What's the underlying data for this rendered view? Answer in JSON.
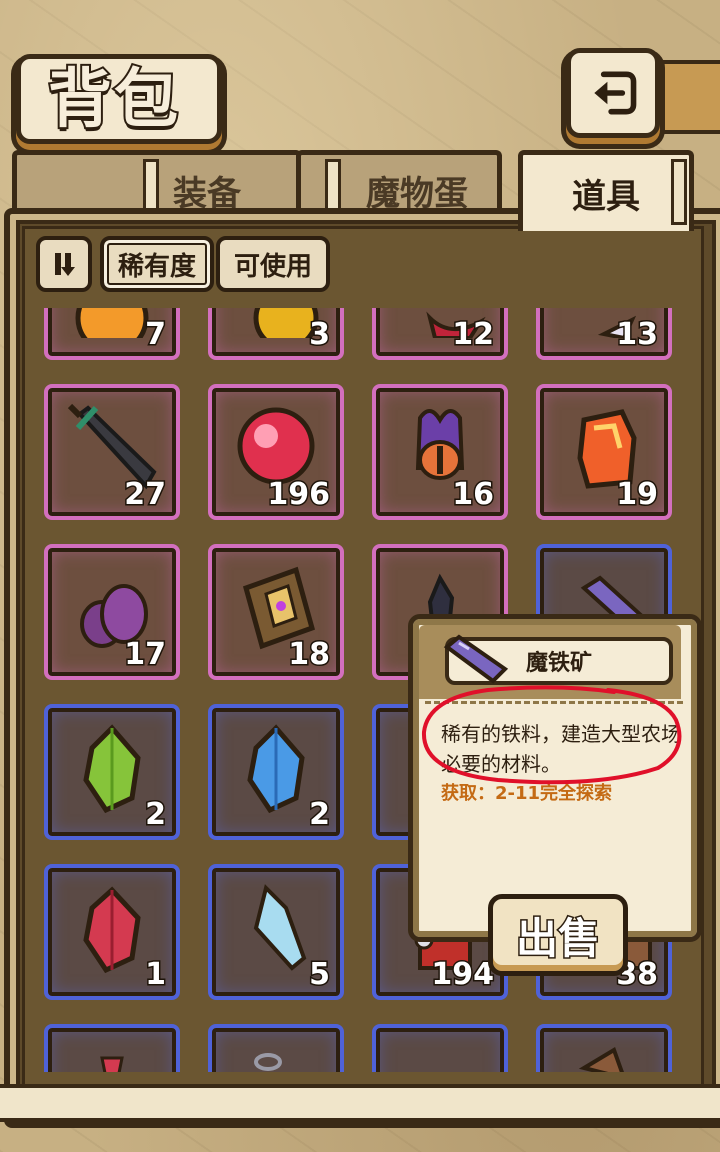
{
  "header": {
    "title": "背包"
  },
  "tabs": [
    {
      "label": "装备",
      "active": false
    },
    {
      "label": "魔物蛋",
      "active": false
    },
    {
      "label": "道具",
      "active": true
    }
  ],
  "toolbar": {
    "filters": [
      {
        "label": "稀有度",
        "selected": true
      },
      {
        "label": "可使用",
        "selected": false
      }
    ]
  },
  "items": [
    {
      "name": "orange-orb-icon",
      "count": "7",
      "rarity": "epic"
    },
    {
      "name": "gold-orb-icon",
      "count": "3",
      "rarity": "epic"
    },
    {
      "name": "red-cloth-icon",
      "count": "12",
      "rarity": "epic"
    },
    {
      "name": "feather-icon",
      "count": "13",
      "rarity": "epic"
    },
    {
      "name": "dark-sword-icon",
      "count": "27",
      "rarity": "epic"
    },
    {
      "name": "red-orb-icon",
      "count": "196",
      "rarity": "epic"
    },
    {
      "name": "eye-tentacle-icon",
      "count": "16",
      "rarity": "epic"
    },
    {
      "name": "fire-crystal-icon",
      "count": "19",
      "rarity": "epic"
    },
    {
      "name": "purple-egg-icon",
      "count": "17",
      "rarity": "epic"
    },
    {
      "name": "spell-book-icon",
      "count": "18",
      "rarity": "epic"
    },
    {
      "name": "dark-crystal-icon",
      "count": "",
      "rarity": "epic"
    },
    {
      "name": "magic-iron-ore-icon",
      "count": "",
      "rarity": "rare"
    },
    {
      "name": "green-crystal-icon",
      "count": "2",
      "rarity": "rare"
    },
    {
      "name": "blue-crystal-icon",
      "count": "2",
      "rarity": "rare"
    },
    {
      "name": "helmet-icon",
      "count": "",
      "rarity": "rare"
    },
    {
      "name": "hidden-item-icon",
      "count": "",
      "rarity": "rare"
    },
    {
      "name": "red-crystal-icon",
      "count": "1",
      "rarity": "rare"
    },
    {
      "name": "ice-shard-icon",
      "count": "5",
      "rarity": "rare"
    },
    {
      "name": "treasure-chest-icon",
      "count": "194",
      "rarity": "rare"
    },
    {
      "name": "wood-crate-icon",
      "count": "38",
      "rarity": "rare"
    },
    {
      "name": "red-gem-icon",
      "count": "",
      "rarity": "rare"
    },
    {
      "name": "chain-icon",
      "count": "",
      "rarity": "rare"
    },
    {
      "name": "empty-icon",
      "count": "",
      "rarity": "rare"
    },
    {
      "name": "wood-plank-icon",
      "count": "",
      "rarity": "rare"
    }
  ],
  "popup": {
    "item_name": "魔铁矿",
    "description": "稀有的铁料，建造大型农场必要的材料。",
    "source": "获取：2-11完全探索",
    "sell_label": "出售"
  },
  "colors": {
    "epic_border": "#d36fbe",
    "rare_border": "#4f62d8",
    "source_text": "#c46a14",
    "annotation": "#e0102a"
  }
}
